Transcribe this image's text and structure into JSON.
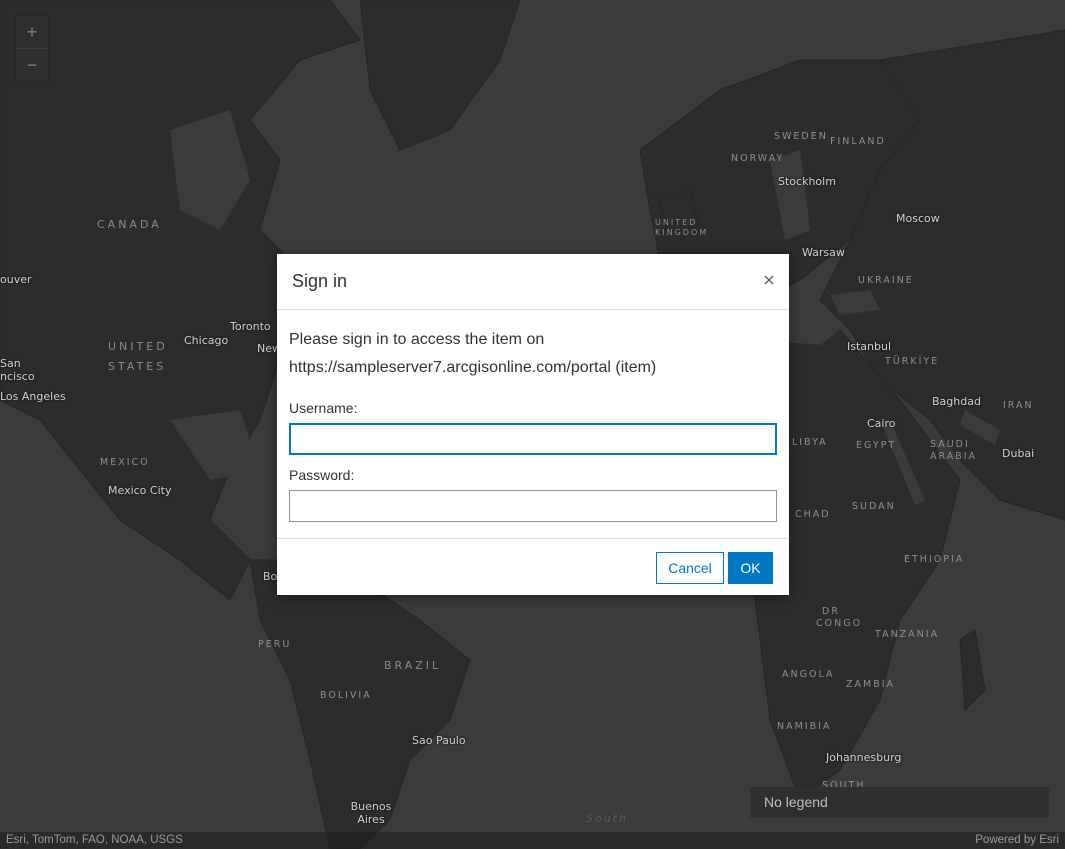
{
  "map": {
    "zoom_in_label": "+",
    "zoom_out_label": "−",
    "labels": {
      "canada": "CANADA",
      "united_states": "UNITED STATES",
      "mexico": "MEXICO",
      "brazil": "BRAZIL",
      "bolivia": "BOLIVIA",
      "peru": "PERU",
      "sweden": "SWEDEN",
      "finland": "FINLAND",
      "norway": "NORWAY",
      "united_kingdom": "UNITED KINGDOM",
      "ukraine": "UKRAINE",
      "turkiye": "TÜRKİYE",
      "iran": "IRAN",
      "egypt": "EGYPT",
      "libya": "LIBYA",
      "saudi_arabia": "SAUDI ARABIA",
      "sudan": "SUDAN",
      "chad": "CHAD",
      "ethiopia": "ETHIOPIA",
      "dr_congo": "DR CONGO",
      "tanzania": "TANZANIA",
      "angola": "ANGOLA",
      "zambia": "ZAMBIA",
      "namibia": "NAMIBIA",
      "south_africa": "SOUTH",
      "ocean_south": "South",
      "vancouver": "ouver",
      "san_francisco_1": "San",
      "san_francisco_2": "ncisco",
      "los_angeles": "Los Angeles",
      "chicago": "Chicago",
      "toronto": "Toronto",
      "new_york": "New",
      "mexico_city": "Mexico City",
      "bogota": "Bo",
      "sao_paulo": "Sao Paulo",
      "buenos_aires": "Buenos Aires",
      "stockholm": "Stockholm",
      "moscow": "Moscow",
      "warsaw": "Warsaw",
      "istanbul": "Istanbul",
      "baghdad": "Baghdad",
      "cairo": "Cairo",
      "dubai": "Dubai",
      "johannesburg": "Johannesburg"
    },
    "legend_text": "No legend",
    "attribution_left": "Esri, TomTom, FAO, NOAA, USGS",
    "attribution_right": "Powered by Esri"
  },
  "dialog": {
    "title": "Sign in",
    "message_line1": "Please sign in to access the item on",
    "message_line2": "https://sampleserver7.arcgisonline.com/portal (item)",
    "username_label": "Username:",
    "username_value": "",
    "password_label": "Password:",
    "password_value": "",
    "cancel_label": "Cancel",
    "ok_label": "OK"
  },
  "colors": {
    "accent": "#0079c1",
    "map_water": "#3b3b3b",
    "map_land": "#2b2b2b"
  }
}
